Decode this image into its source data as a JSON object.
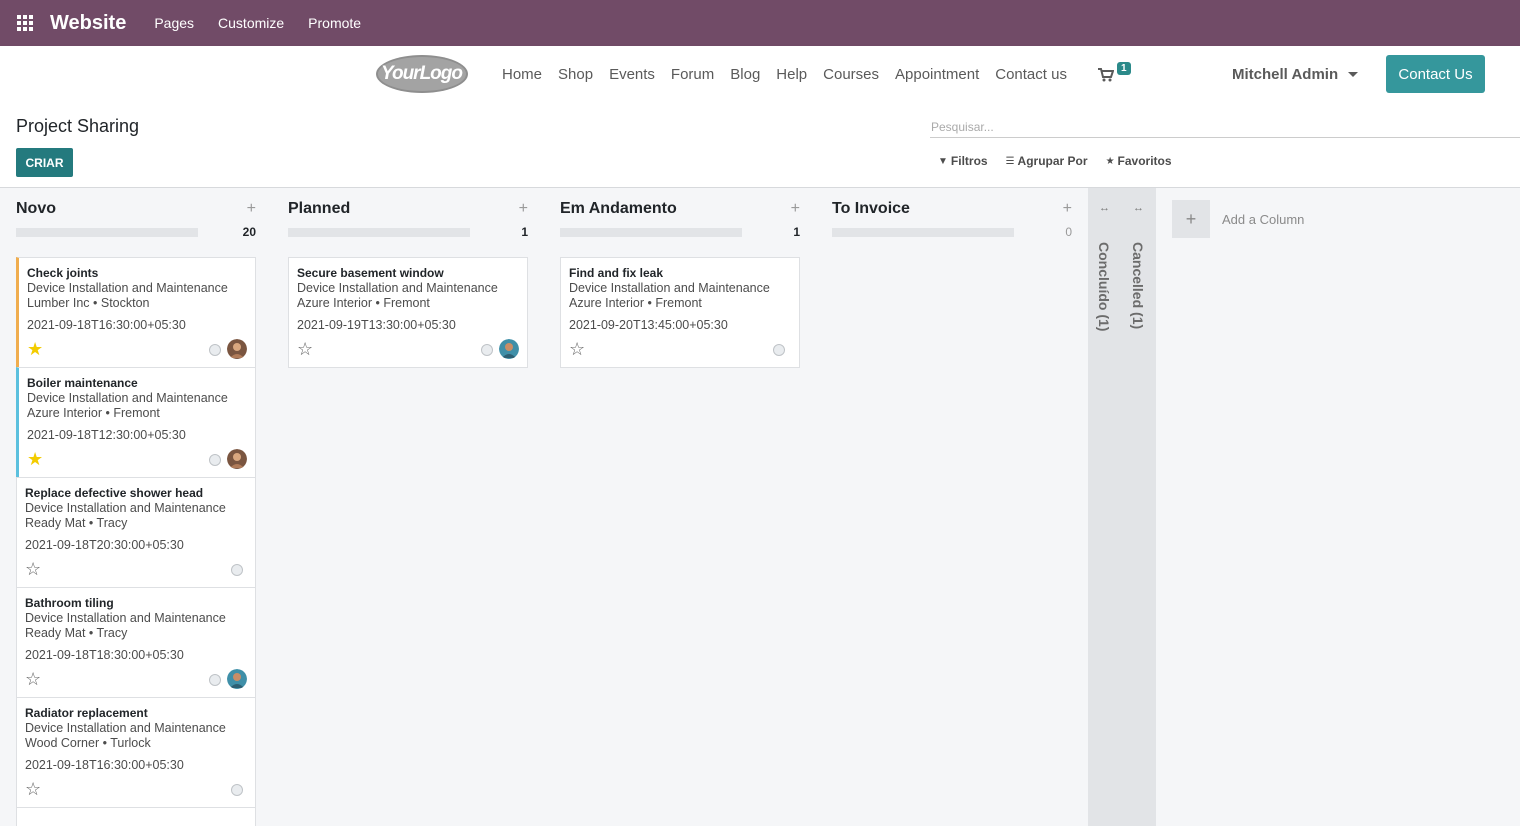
{
  "admin_bar": {
    "app_title": "Website",
    "menu": [
      "Pages",
      "Customize",
      "Promote"
    ]
  },
  "site_header": {
    "logo_text": "YourLogo",
    "nav": [
      "Home",
      "Shop",
      "Events",
      "Forum",
      "Blog",
      "Help",
      "Courses",
      "Appointment",
      "Contact us"
    ],
    "cart_count": "1",
    "user_name": "Mitchell Admin",
    "contact_button": "Contact Us"
  },
  "control_panel": {
    "title": "Project Sharing",
    "create_label": "CRIAR",
    "search_placeholder": "Pesquisar...",
    "filters_label": "Filtros",
    "group_by_label": "Agrupar Por",
    "favorites_label": "Favoritos"
  },
  "columns": [
    {
      "title": "Novo",
      "count": "20"
    },
    {
      "title": "Planned",
      "count": "1"
    },
    {
      "title": "Em Andamento",
      "count": "1"
    },
    {
      "title": "To Invoice",
      "count": "0"
    }
  ],
  "cards": {
    "novo": [
      {
        "title": "Check joints",
        "project": "Device Installation and Maintenance",
        "customer": "Lumber Inc • Stockton",
        "date": "2021-09-18T16:30:00+05:30"
      },
      {
        "title": "Boiler maintenance",
        "project": "Device Installation and Maintenance",
        "customer": "Azure Interior • Fremont",
        "date": "2021-09-18T12:30:00+05:30"
      },
      {
        "title": "Replace defective shower head",
        "project": "Device Installation and Maintenance",
        "customer": "Ready Mat • Tracy",
        "date": "2021-09-18T20:30:00+05:30"
      },
      {
        "title": "Bathroom tiling",
        "project": "Device Installation and Maintenance",
        "customer": "Ready Mat • Tracy",
        "date": "2021-09-18T18:30:00+05:30"
      },
      {
        "title": "Radiator replacement",
        "project": "Device Installation and Maintenance",
        "customer": "Wood Corner • Turlock",
        "date": "2021-09-18T16:30:00+05:30"
      }
    ],
    "planned": [
      {
        "title": "Secure basement window",
        "project": "Device Installation and Maintenance",
        "customer": "Azure Interior • Fremont",
        "date": "2021-09-19T13:30:00+05:30"
      }
    ],
    "in_progress": [
      {
        "title": "Find and fix leak",
        "project": "Device Installation and Maintenance",
        "customer": "Azure Interior • Fremont",
        "date": "2021-09-20T13:45:00+05:30"
      }
    ]
  },
  "folded_columns": [
    "Concluído (1)",
    "Cancelled (1)"
  ],
  "add_column_label": "Add a Column",
  "colors": {
    "admin_bar": "#714b67",
    "primary": "#247a7e",
    "contact_button": "#35979c",
    "priority_star": "#f3cc00"
  }
}
